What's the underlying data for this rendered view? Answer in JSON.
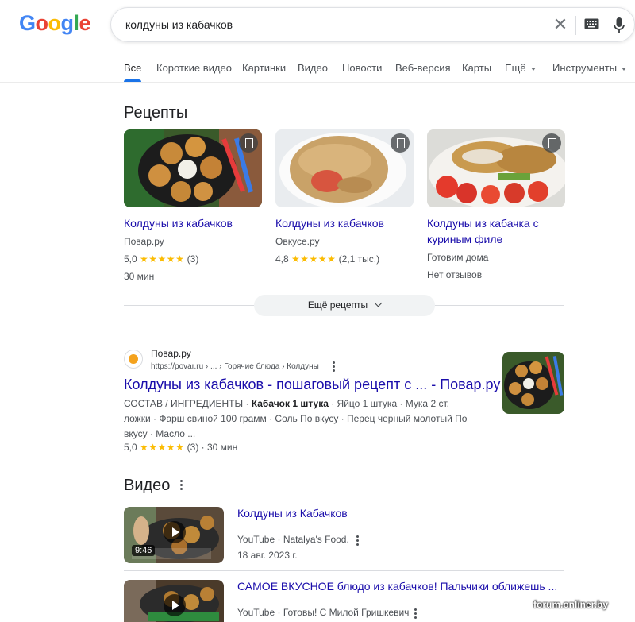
{
  "logo": {
    "letters": [
      "G",
      "o",
      "o",
      "g",
      "l",
      "e"
    ],
    "colors": [
      "#4285F4",
      "#EA4335",
      "#FBBC05",
      "#4285F4",
      "#34A853",
      "#EA4335"
    ]
  },
  "search": {
    "query": "колдуны из кабачков"
  },
  "tabs": [
    {
      "label": "Все",
      "active": true
    },
    {
      "label": "Короткие видео"
    },
    {
      "label": "Картинки"
    },
    {
      "label": "Видео"
    },
    {
      "label": "Новости"
    },
    {
      "label": "Веб-версия"
    },
    {
      "label": "Карты"
    },
    {
      "label": "Ещё"
    },
    {
      "label": "Инструменты"
    }
  ],
  "recipes": {
    "heading": "Рецепты",
    "items": [
      {
        "title": "Колдуны из кабачков",
        "source": "Повар.ру",
        "rating": "5,0",
        "stars": "★★★★★",
        "count": "(3)",
        "extra": "30 мин"
      },
      {
        "title": "Колдуны из кабачков",
        "source": "Овкусе.ру",
        "rating": "4,8",
        "stars": "★★★★★",
        "count": "(2,1 тыс.)",
        "extra": ""
      },
      {
        "title": "Колдуны из кабачка с куриным филе",
        "source": "Готовим дома",
        "rating": "",
        "stars": "",
        "count": "",
        "extra": "Нет отзывов"
      }
    ],
    "more_label": "Ещё рецепты"
  },
  "result": {
    "site_name": "Повар.ру",
    "url": "https://povar.ru › ... › Горячие блюда › Колдуны",
    "title": "Колдуны из кабачков - пошаговый рецепт с ... - Повар.ру",
    "snippet_parts": [
      "СОСТАВ / ИНГРЕДИЕНТЫ · ",
      "Кабачок 1 штука",
      " · Яйцо 1 штука · Мука 2 ст. ложки · Фарш свиной 100 грамм · Соль По вкусу · Перец черный молотый По вкусу · Масло ..."
    ],
    "rating": "5,0",
    "stars": "★★★★★",
    "meta_rest": "(3) · 30 мин"
  },
  "videos": {
    "heading": "Видео",
    "items": [
      {
        "title": "Колдуны из Кабачков",
        "source": "YouTube · Natalya's Food.",
        "date": "18 авг. 2023 г.",
        "duration": "9:46"
      },
      {
        "title": "САМОЕ ВКУСНОЕ блюдо из кабачков! Пальчики оближешь ...",
        "source": "YouTube · Готовы! С Милой Гришкевич",
        "date": "",
        "duration": ""
      }
    ]
  },
  "watermark": "forum.onliner.by"
}
